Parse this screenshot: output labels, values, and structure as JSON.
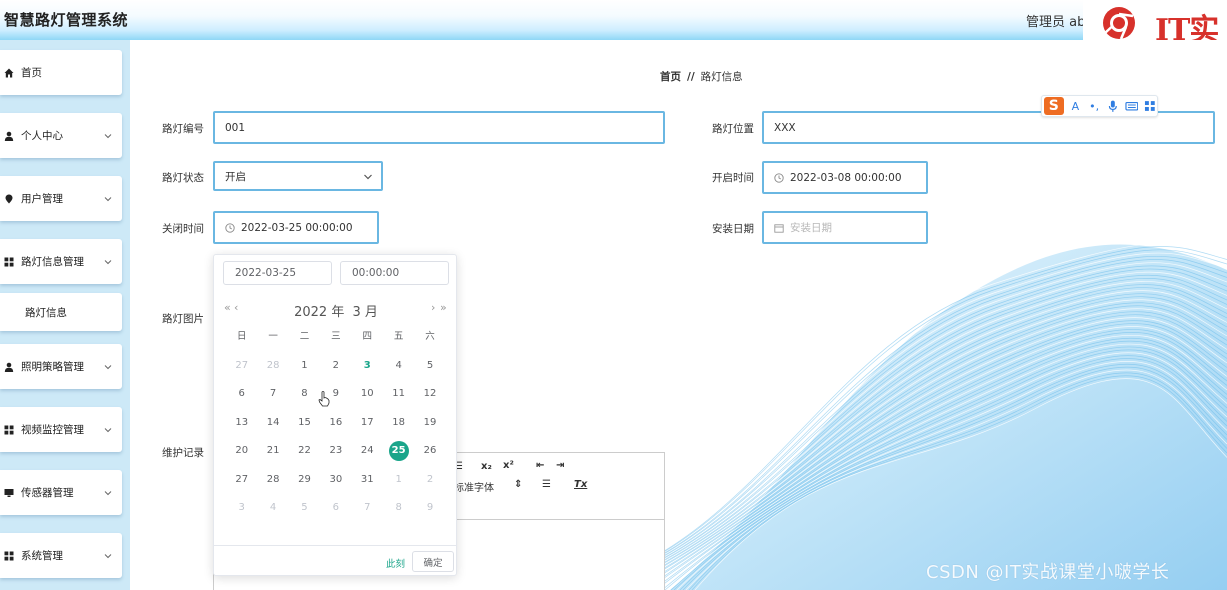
{
  "header": {
    "title": "智慧路灯管理系统",
    "admin_label": "管理员 ab"
  },
  "logo": {
    "brand_text": "IT实",
    "brand_color": "#d7312b"
  },
  "sidebar": {
    "items": [
      {
        "label": "首页",
        "icon": "home-icon",
        "has_chevron": false
      },
      {
        "label": "个人中心",
        "icon": "user-icon",
        "has_chevron": true
      },
      {
        "label": "用户管理",
        "icon": "pin-icon",
        "has_chevron": true
      },
      {
        "label": "路灯信息管理",
        "icon": "grid-icon",
        "has_chevron": true
      },
      {
        "label": "路灯信息",
        "icon": "",
        "has_chevron": false
      },
      {
        "label": "照明策略管理",
        "icon": "user-icon",
        "has_chevron": true
      },
      {
        "label": "视频监控管理",
        "icon": "grid-icon",
        "has_chevron": true
      },
      {
        "label": "传感器管理",
        "icon": "monitor-icon",
        "has_chevron": true
      },
      {
        "label": "系统管理",
        "icon": "grid-icon",
        "has_chevron": true
      }
    ]
  },
  "breadcrumb": {
    "home": "首页",
    "separator": "//",
    "current": "路灯信息"
  },
  "form": {
    "light_id": {
      "label": "路灯编号",
      "value": "001"
    },
    "location": {
      "label": "路灯位置",
      "value": "XXX"
    },
    "status": {
      "label": "路灯状态",
      "value": "开启"
    },
    "open_time": {
      "label": "开启时间",
      "value": "2022-03-08 00:00:00"
    },
    "close_time": {
      "label": "关闭时间",
      "value": "2022-03-25 00:00:00"
    },
    "install_date": {
      "label": "安装日期",
      "placeholder": "安装日期"
    },
    "image": {
      "label": "路灯图片"
    },
    "maintenance": {
      "label": "维护记录"
    }
  },
  "editor": {
    "toolbar_sub": "x₂",
    "toolbar_sup": "x²",
    "font_label": "标准字体",
    "clear_format": "Tx"
  },
  "date_picker": {
    "date_input": "2022-03-25",
    "time_input": "00:00:00",
    "year": "2022 年",
    "month": "3 月",
    "prev_year": "«",
    "prev_month": "‹",
    "next_month": "›",
    "next_year": "»",
    "weekdays": [
      "日",
      "一",
      "二",
      "三",
      "四",
      "五",
      "六"
    ],
    "weeks": [
      [
        "27",
        "28",
        "1",
        "2",
        "3",
        "4",
        "5"
      ],
      [
        "6",
        "7",
        "8",
        "9",
        "10",
        "11",
        "12"
      ],
      [
        "13",
        "14",
        "15",
        "16",
        "17",
        "18",
        "19"
      ],
      [
        "20",
        "21",
        "22",
        "23",
        "24",
        "25",
        "26"
      ],
      [
        "27",
        "28",
        "29",
        "30",
        "31",
        "1",
        "2"
      ],
      [
        "3",
        "4",
        "5",
        "6",
        "7",
        "8",
        "9"
      ]
    ],
    "today": "3",
    "selected": "25",
    "now_label": "此刻",
    "ok_label": "确定",
    "accent_color": "#1aa58a"
  },
  "watermark": "CSDN @IT实战课堂小啵学长"
}
